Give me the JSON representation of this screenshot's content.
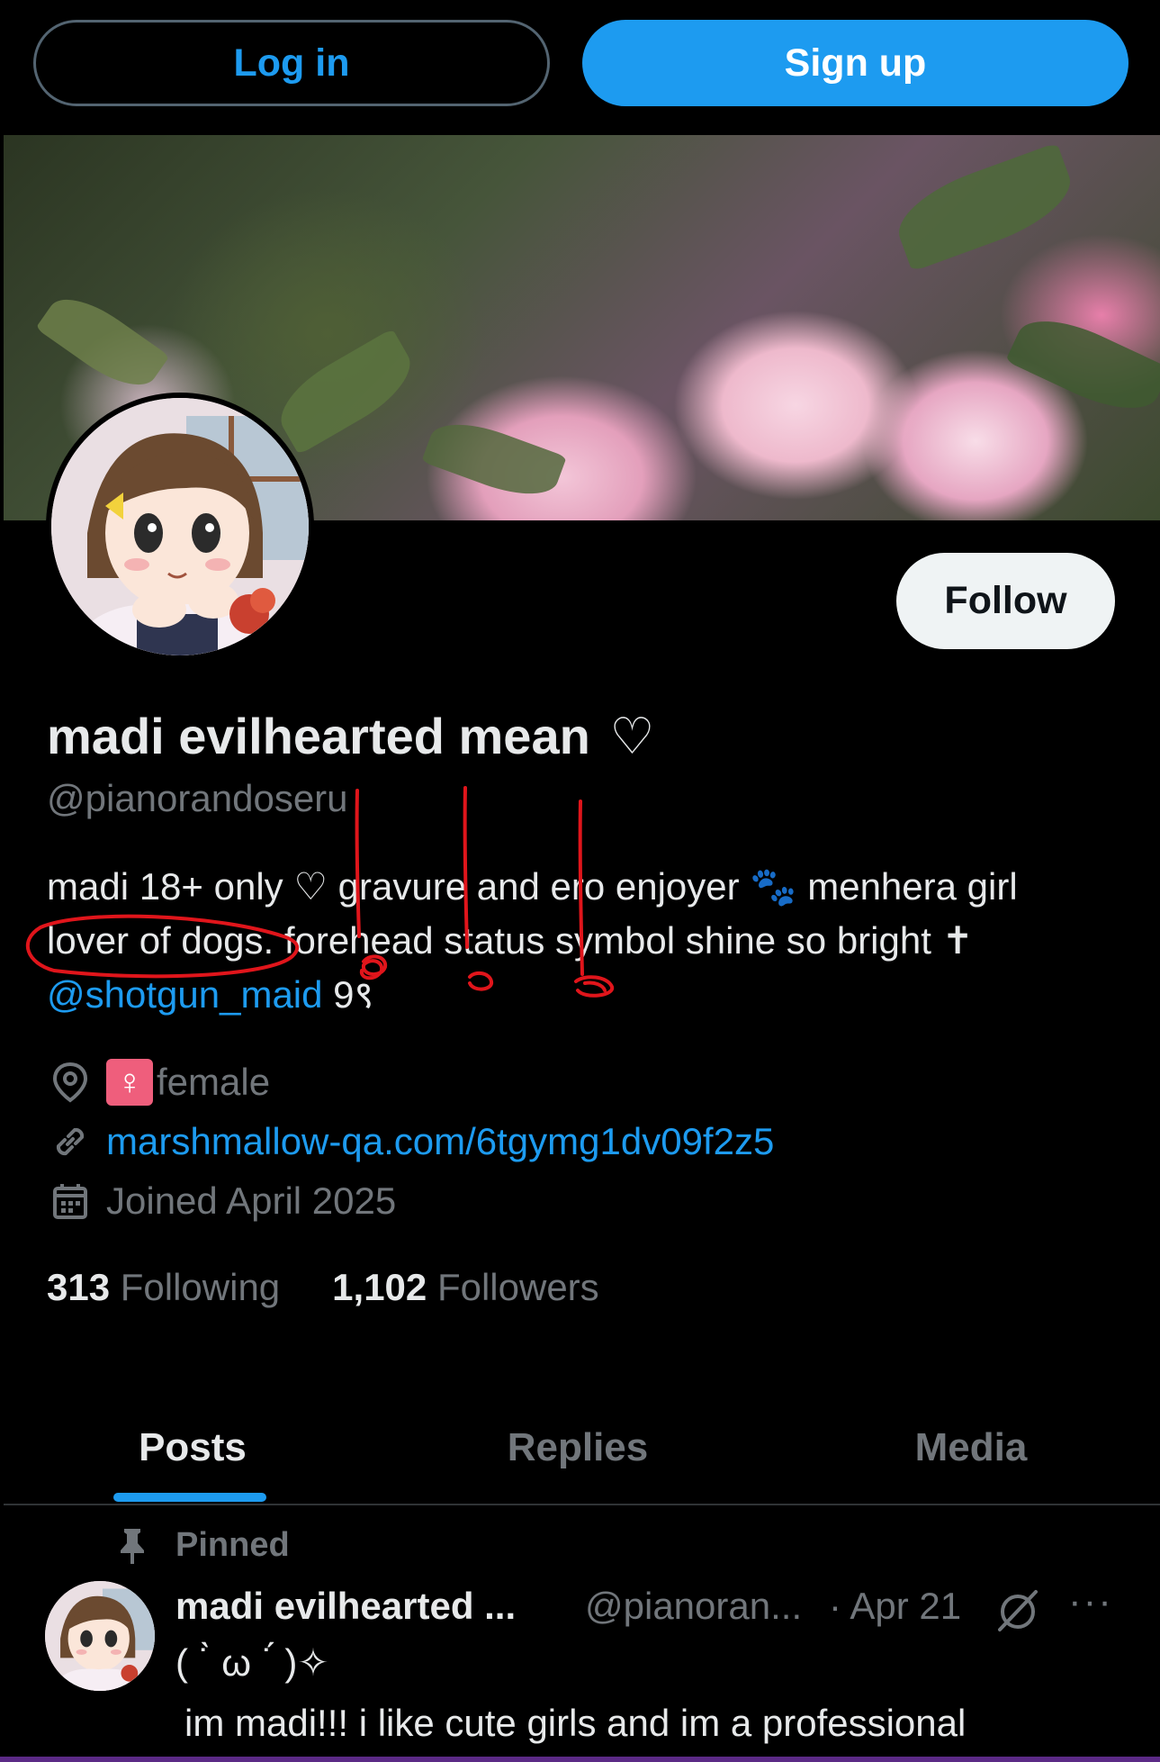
{
  "auth": {
    "login_label": "Log in",
    "signup_label": "Sign up"
  },
  "profile": {
    "display_name": "madi evilhearted mean",
    "name_emoji": "♡",
    "handle": "@pianorandoseru",
    "follow_label": "Follow",
    "bio": {
      "line1_a": "madi 18+ only ♡ gravure and ero enjoyer ",
      "line1_paw": "🐾",
      "line1_b": " menhera girl",
      "line2": "lover of dogs. forehead status symbol shine so bright ✝",
      "line3_mention": "@shotgun_maid",
      "line3_suffix": " 9९"
    },
    "location_badge": "♀",
    "location": "female",
    "website": "marshmallow-qa.com/6tgymg1dv09f2z5",
    "joined": "Joined April 2025",
    "following_count": "313",
    "following_label": "Following",
    "followers_count": "1,102",
    "followers_label": "Followers"
  },
  "tabs": [
    {
      "label": "Posts",
      "active": true
    },
    {
      "label": "Replies",
      "active": false
    },
    {
      "label": "Media",
      "active": false
    }
  ],
  "post": {
    "pinned_label": "Pinned",
    "author_name": "madi evilhearted ...",
    "author_handle": "@pianoran...",
    "date": "· Apr 21",
    "more": "···",
    "line1": "( ˙̀ ω ˙́ )✧",
    "line2": "im madi!!! i like cute girls and im a professional"
  },
  "colors": {
    "accent": "#1d9bf0",
    "background": "#000000",
    "text_primary": "#e7e9ea",
    "text_secondary": "#71767b",
    "annotation_red": "#e0151b"
  },
  "icons": [
    "location-pin-icon",
    "link-icon",
    "calendar-icon",
    "pin-icon",
    "mute-icon",
    "more-icon",
    "paw-icon",
    "venus-icon",
    "heart-icon"
  ]
}
